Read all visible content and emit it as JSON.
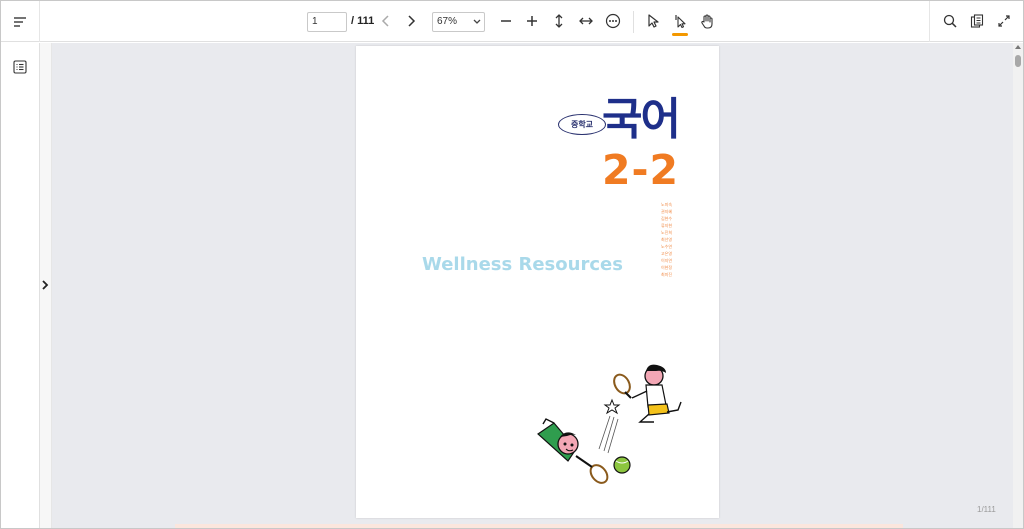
{
  "toolbar": {
    "page_input_value": "1",
    "page_total": "/ 111",
    "zoom_value": "67%"
  },
  "document": {
    "badge": "중학교",
    "subject": "국어",
    "grade": "2-2",
    "authors": [
      "노미숙",
      "권지혜",
      "김현수",
      "류지현",
      "노진희",
      "최선영",
      "노수연",
      "고은영",
      "이지연",
      "이현정",
      "최미진"
    ],
    "watermark": "Wellness Resources",
    "page_counter": "1/111"
  },
  "colors": {
    "accent": "#f39800",
    "title_blue": "#1e2f8a",
    "title_orange": "#f07b22",
    "watermark": "#a9d9ea",
    "viewer_bg": "#e9eaee"
  },
  "icons": [
    "menu-lines-icon",
    "chevron-left-icon",
    "chevron-right-icon",
    "zoom-out-icon",
    "zoom-in-icon",
    "fit-height-icon",
    "fit-width-icon",
    "more-icon",
    "select-pointer-icon",
    "text-select-icon",
    "hand-pan-icon",
    "search-icon",
    "document-info-icon",
    "fullscreen-icon",
    "outline-list-icon",
    "sidebar-expand-icon"
  ]
}
